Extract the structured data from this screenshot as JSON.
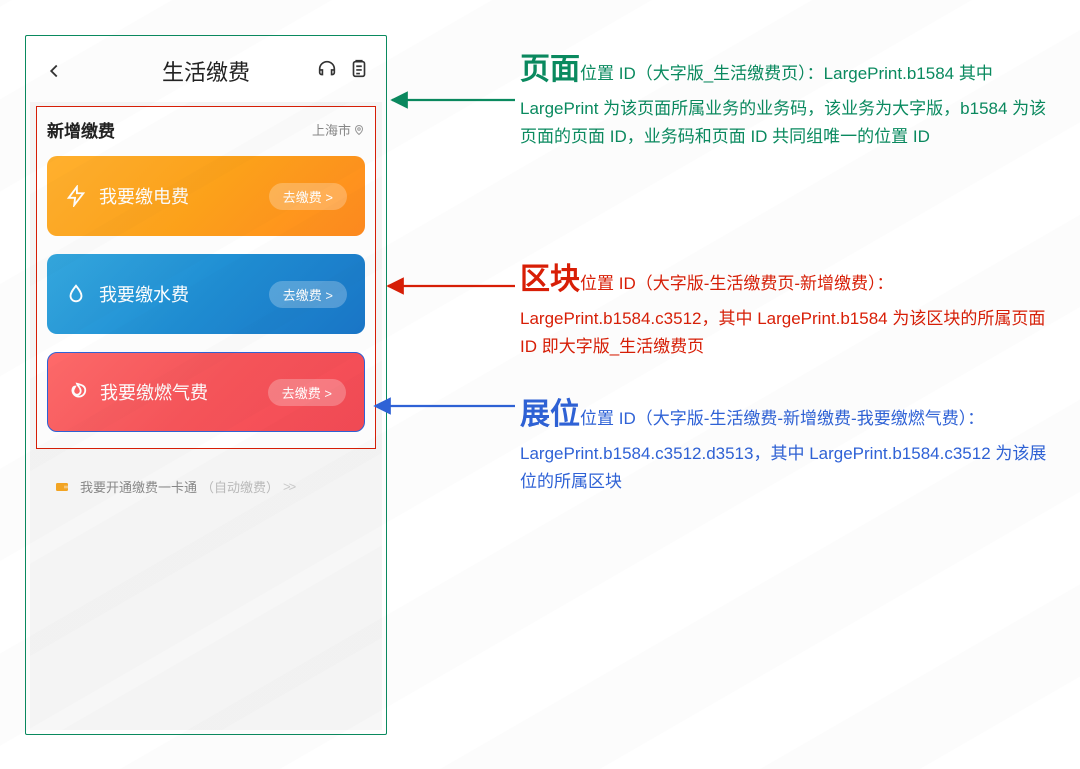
{
  "phone": {
    "title": "生活缴费",
    "section_title": "新增缴费",
    "location": "上海市",
    "cards": [
      {
        "title": "我要缴电费",
        "button": "去缴费 >"
      },
      {
        "title": "我要缴水费",
        "button": "去缴费 >"
      },
      {
        "title": "我要缴燃气费",
        "button": "去缴费 >"
      }
    ],
    "one_card_main": "我要开通缴费一卡通",
    "one_card_sub": "（自动缴费）",
    "one_card_chev": ">>"
  },
  "annotations": {
    "page": {
      "heading": "页面",
      "body": "位置 ID（大字版_生活缴费页）：LargePrint.b1584 其中 LargePrint 为该页面所属业务的业务码，该业务为大字版，b1584 为该页面的页面 ID，业务码和页面 ID 共同组唯一的位置 ID"
    },
    "block": {
      "heading": "区块",
      "body": "位置 ID（大字版-生活缴费页-新增缴费）：LargePrint.b1584.c3512，其中 LargePrint.b1584 为该区块的所属页面 ID 即大字版_生活缴费页"
    },
    "spot": {
      "heading": "展位",
      "body": "位置 ID（大字版-生活缴费-新增缴费-我要缴燃气费）： LargePrint.b1584.c3512.d3513，其中 LargePrint.b1584.c3512 为该展位的所属区块"
    }
  }
}
